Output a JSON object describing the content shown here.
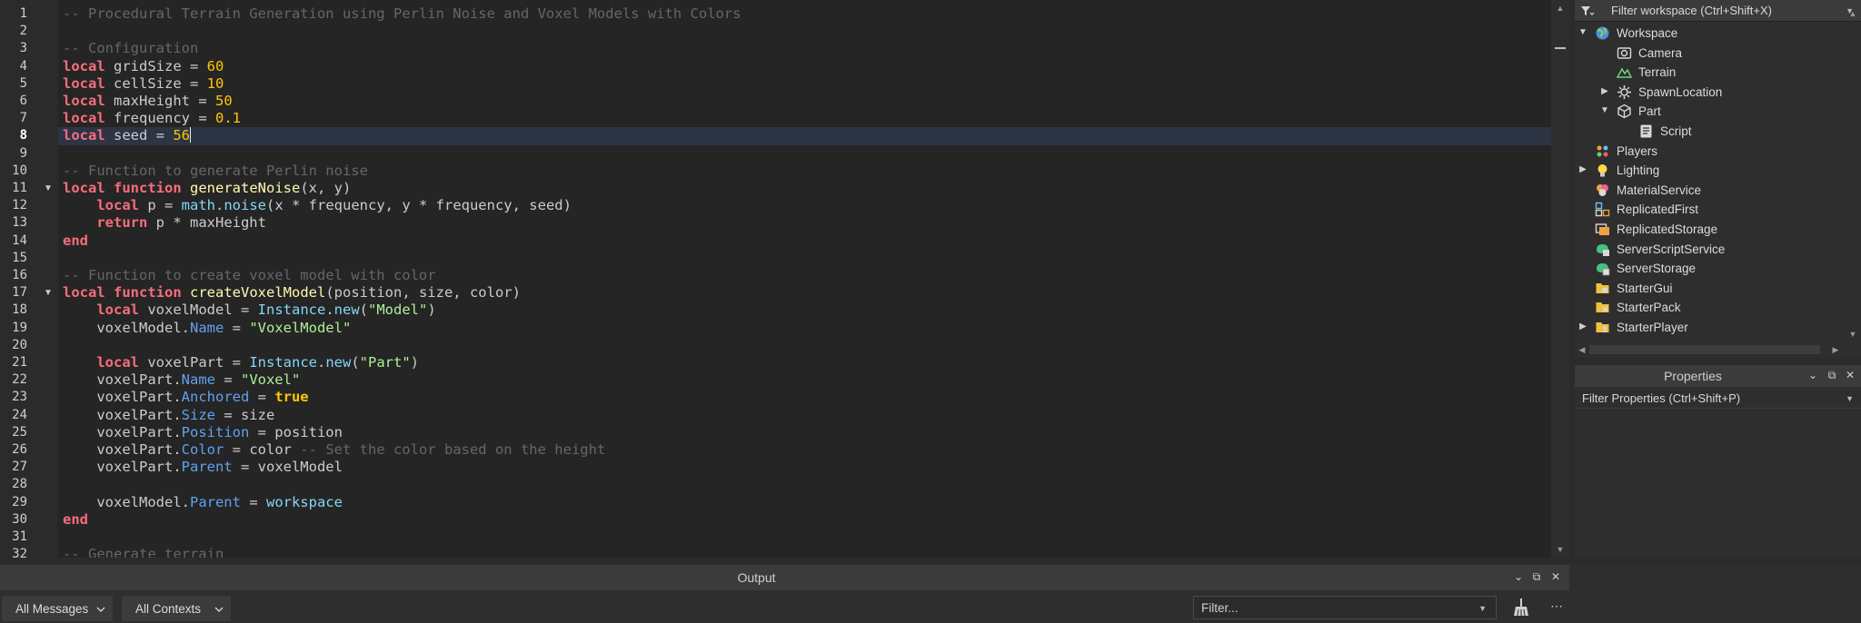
{
  "editor": {
    "active_line": 8,
    "lines": [
      {
        "n": 1,
        "fold": false,
        "tokens": [
          {
            "t": "cm",
            "v": "-- Procedural Terrain Generation using Perlin Noise and Voxel Models with Colors"
          }
        ]
      },
      {
        "n": 2,
        "fold": false,
        "tokens": []
      },
      {
        "n": 3,
        "fold": false,
        "tokens": [
          {
            "t": "cm",
            "v": "-- Configuration"
          }
        ]
      },
      {
        "n": 4,
        "fold": false,
        "tokens": [
          {
            "t": "kw",
            "v": "local"
          },
          {
            "t": "id",
            "v": " gridSize = "
          },
          {
            "t": "num",
            "v": "60"
          }
        ]
      },
      {
        "n": 5,
        "fold": false,
        "tokens": [
          {
            "t": "kw",
            "v": "local"
          },
          {
            "t": "id",
            "v": " cellSize = "
          },
          {
            "t": "num",
            "v": "10"
          }
        ]
      },
      {
        "n": 6,
        "fold": false,
        "tokens": [
          {
            "t": "kw",
            "v": "local"
          },
          {
            "t": "id",
            "v": " maxHeight = "
          },
          {
            "t": "num",
            "v": "50"
          }
        ]
      },
      {
        "n": 7,
        "fold": false,
        "tokens": [
          {
            "t": "kw",
            "v": "local"
          },
          {
            "t": "id",
            "v": " frequency = "
          },
          {
            "t": "num",
            "v": "0.1"
          }
        ]
      },
      {
        "n": 8,
        "fold": false,
        "tokens": [
          {
            "t": "kw",
            "v": "local"
          },
          {
            "t": "id",
            "v": " seed = "
          },
          {
            "t": "num",
            "v": "56"
          }
        ]
      },
      {
        "n": 9,
        "fold": false,
        "tokens": []
      },
      {
        "n": 10,
        "fold": false,
        "tokens": [
          {
            "t": "cm",
            "v": "-- Function to generate Perlin noise"
          }
        ]
      },
      {
        "n": 11,
        "fold": true,
        "tokens": [
          {
            "t": "kw",
            "v": "local"
          },
          {
            "t": "id",
            "v": " "
          },
          {
            "t": "kw",
            "v": "function"
          },
          {
            "t": "id",
            "v": " "
          },
          {
            "t": "fn",
            "v": "generateNoise"
          },
          {
            "t": "id",
            "v": "(x, y)"
          }
        ]
      },
      {
        "n": 12,
        "fold": false,
        "tokens": [
          {
            "t": "id",
            "v": "    "
          },
          {
            "t": "kw",
            "v": "local"
          },
          {
            "t": "id",
            "v": " p = "
          },
          {
            "t": "bi",
            "v": "math"
          },
          {
            "t": "id",
            "v": "."
          },
          {
            "t": "bi",
            "v": "noise"
          },
          {
            "t": "id",
            "v": "(x * frequency, y * frequency, seed)"
          }
        ]
      },
      {
        "n": 13,
        "fold": false,
        "tokens": [
          {
            "t": "id",
            "v": "    "
          },
          {
            "t": "kw",
            "v": "return"
          },
          {
            "t": "id",
            "v": " p * maxHeight"
          }
        ]
      },
      {
        "n": 14,
        "fold": false,
        "tokens": [
          {
            "t": "kw",
            "v": "end"
          }
        ]
      },
      {
        "n": 15,
        "fold": false,
        "tokens": []
      },
      {
        "n": 16,
        "fold": false,
        "tokens": [
          {
            "t": "cm",
            "v": "-- Function to create voxel model with color"
          }
        ]
      },
      {
        "n": 17,
        "fold": true,
        "tokens": [
          {
            "t": "kw",
            "v": "local"
          },
          {
            "t": "id",
            "v": " "
          },
          {
            "t": "kw",
            "v": "function"
          },
          {
            "t": "id",
            "v": " "
          },
          {
            "t": "fn",
            "v": "createVoxelModel"
          },
          {
            "t": "id",
            "v": "(position, size, color)"
          }
        ]
      },
      {
        "n": 18,
        "fold": false,
        "tokens": [
          {
            "t": "id",
            "v": "    "
          },
          {
            "t": "kw",
            "v": "local"
          },
          {
            "t": "id",
            "v": " voxelModel = "
          },
          {
            "t": "bi",
            "v": "Instance"
          },
          {
            "t": "id",
            "v": "."
          },
          {
            "t": "bi",
            "v": "new"
          },
          {
            "t": "id",
            "v": "("
          },
          {
            "t": "str",
            "v": "\"Model\""
          },
          {
            "t": "id",
            "v": ")"
          }
        ]
      },
      {
        "n": 19,
        "fold": false,
        "tokens": [
          {
            "t": "id",
            "v": "    voxelModel."
          },
          {
            "t": "prop",
            "v": "Name"
          },
          {
            "t": "id",
            "v": " = "
          },
          {
            "t": "str",
            "v": "\"VoxelModel\""
          }
        ]
      },
      {
        "n": 20,
        "fold": false,
        "tokens": []
      },
      {
        "n": 21,
        "fold": false,
        "tokens": [
          {
            "t": "id",
            "v": "    "
          },
          {
            "t": "kw",
            "v": "local"
          },
          {
            "t": "id",
            "v": " voxelPart = "
          },
          {
            "t": "bi",
            "v": "Instance"
          },
          {
            "t": "id",
            "v": "."
          },
          {
            "t": "bi",
            "v": "new"
          },
          {
            "t": "id",
            "v": "("
          },
          {
            "t": "str",
            "v": "\"Part\""
          },
          {
            "t": "id",
            "v": ")"
          }
        ]
      },
      {
        "n": 22,
        "fold": false,
        "tokens": [
          {
            "t": "id",
            "v": "    voxelPart."
          },
          {
            "t": "prop",
            "v": "Name"
          },
          {
            "t": "id",
            "v": " = "
          },
          {
            "t": "str",
            "v": "\"Voxel\""
          }
        ]
      },
      {
        "n": 23,
        "fold": false,
        "tokens": [
          {
            "t": "id",
            "v": "    voxelPart."
          },
          {
            "t": "prop",
            "v": "Anchored"
          },
          {
            "t": "id",
            "v": " = "
          },
          {
            "t": "bool",
            "v": "true"
          }
        ]
      },
      {
        "n": 24,
        "fold": false,
        "tokens": [
          {
            "t": "id",
            "v": "    voxelPart."
          },
          {
            "t": "prop",
            "v": "Size"
          },
          {
            "t": "id",
            "v": " = size"
          }
        ]
      },
      {
        "n": 25,
        "fold": false,
        "tokens": [
          {
            "t": "id",
            "v": "    voxelPart."
          },
          {
            "t": "prop",
            "v": "Position"
          },
          {
            "t": "id",
            "v": " = position"
          }
        ]
      },
      {
        "n": 26,
        "fold": false,
        "tokens": [
          {
            "t": "id",
            "v": "    voxelPart."
          },
          {
            "t": "prop",
            "v": "Color"
          },
          {
            "t": "id",
            "v": " = color "
          },
          {
            "t": "cm",
            "v": "-- Set the color based on the height"
          }
        ]
      },
      {
        "n": 27,
        "fold": false,
        "tokens": [
          {
            "t": "id",
            "v": "    voxelPart."
          },
          {
            "t": "prop",
            "v": "Parent"
          },
          {
            "t": "id",
            "v": " = voxelModel"
          }
        ]
      },
      {
        "n": 28,
        "fold": false,
        "tokens": []
      },
      {
        "n": 29,
        "fold": false,
        "tokens": [
          {
            "t": "id",
            "v": "    voxelModel."
          },
          {
            "t": "prop",
            "v": "Parent"
          },
          {
            "t": "id",
            "v": " = "
          },
          {
            "t": "bi",
            "v": "workspace"
          }
        ]
      },
      {
        "n": 30,
        "fold": false,
        "tokens": [
          {
            "t": "kw",
            "v": "end"
          }
        ]
      },
      {
        "n": 31,
        "fold": false,
        "tokens": []
      },
      {
        "n": 32,
        "fold": false,
        "tokens": [
          {
            "t": "cm",
            "v": "-- Generate terrain"
          }
        ]
      }
    ]
  },
  "explorer": {
    "filter_label": "Filter workspace (Ctrl+Shift+X)",
    "items": [
      {
        "label": "Workspace",
        "depth": 0,
        "arrow": "expanded",
        "icon": "globe-icon",
        "name": "workspace"
      },
      {
        "label": "Camera",
        "depth": 1,
        "arrow": "none",
        "icon": "camera-icon",
        "name": "camera"
      },
      {
        "label": "Terrain",
        "depth": 1,
        "arrow": "none",
        "icon": "terrain-icon",
        "name": "terrain"
      },
      {
        "label": "SpawnLocation",
        "depth": 1,
        "arrow": "collapsed",
        "icon": "spawn-location-icon",
        "name": "spawnlocation"
      },
      {
        "label": "Part",
        "depth": 1,
        "arrow": "expanded",
        "icon": "part-cube-icon",
        "name": "part"
      },
      {
        "label": "Script",
        "depth": 2,
        "arrow": "none",
        "icon": "script-icon",
        "name": "script"
      },
      {
        "label": "Players",
        "depth": 0,
        "arrow": "none",
        "icon": "players-icon",
        "name": "players"
      },
      {
        "label": "Lighting",
        "depth": 0,
        "arrow": "collapsed",
        "icon": "lightbulb-icon",
        "name": "lighting"
      },
      {
        "label": "MaterialService",
        "depth": 0,
        "arrow": "none",
        "icon": "material-service-icon",
        "name": "materialservice"
      },
      {
        "label": "ReplicatedFirst",
        "depth": 0,
        "arrow": "none",
        "icon": "replicated-first-icon",
        "name": "replicatedfirst"
      },
      {
        "label": "ReplicatedStorage",
        "depth": 0,
        "arrow": "none",
        "icon": "replicated-storage-icon",
        "name": "replicatedstorage"
      },
      {
        "label": "ServerScriptService",
        "depth": 0,
        "arrow": "none",
        "icon": "server-script-service-icon",
        "name": "serverscriptservice"
      },
      {
        "label": "ServerStorage",
        "depth": 0,
        "arrow": "none",
        "icon": "server-storage-icon",
        "name": "serverstorage"
      },
      {
        "label": "StarterGui",
        "depth": 0,
        "arrow": "none",
        "icon": "starter-gui-icon",
        "name": "startergui"
      },
      {
        "label": "StarterPack",
        "depth": 0,
        "arrow": "none",
        "icon": "starter-pack-icon",
        "name": "starterpack"
      },
      {
        "label": "StarterPlayer",
        "depth": 0,
        "arrow": "collapsed",
        "icon": "starter-player-icon",
        "name": "starterplayer"
      }
    ]
  },
  "properties": {
    "title": "Properties",
    "filter_label": "Filter Properties (Ctrl+Shift+P)"
  },
  "output": {
    "title": "Output",
    "messages_dropdown": "All Messages",
    "contexts_dropdown": "All Contexts",
    "filter_placeholder": "Filter..."
  },
  "colors": {
    "keyword": "#f86d7c",
    "function_name": "#fdfbac",
    "number": "#ffc600",
    "string": "#adf195",
    "builtin": "#84d6f7",
    "property": "#61a1f1",
    "comment": "#666666",
    "text": "#cccccc",
    "current_line": "#2d3444",
    "panel_background": "#2e2e2e",
    "header_background": "#3b3b3b"
  }
}
